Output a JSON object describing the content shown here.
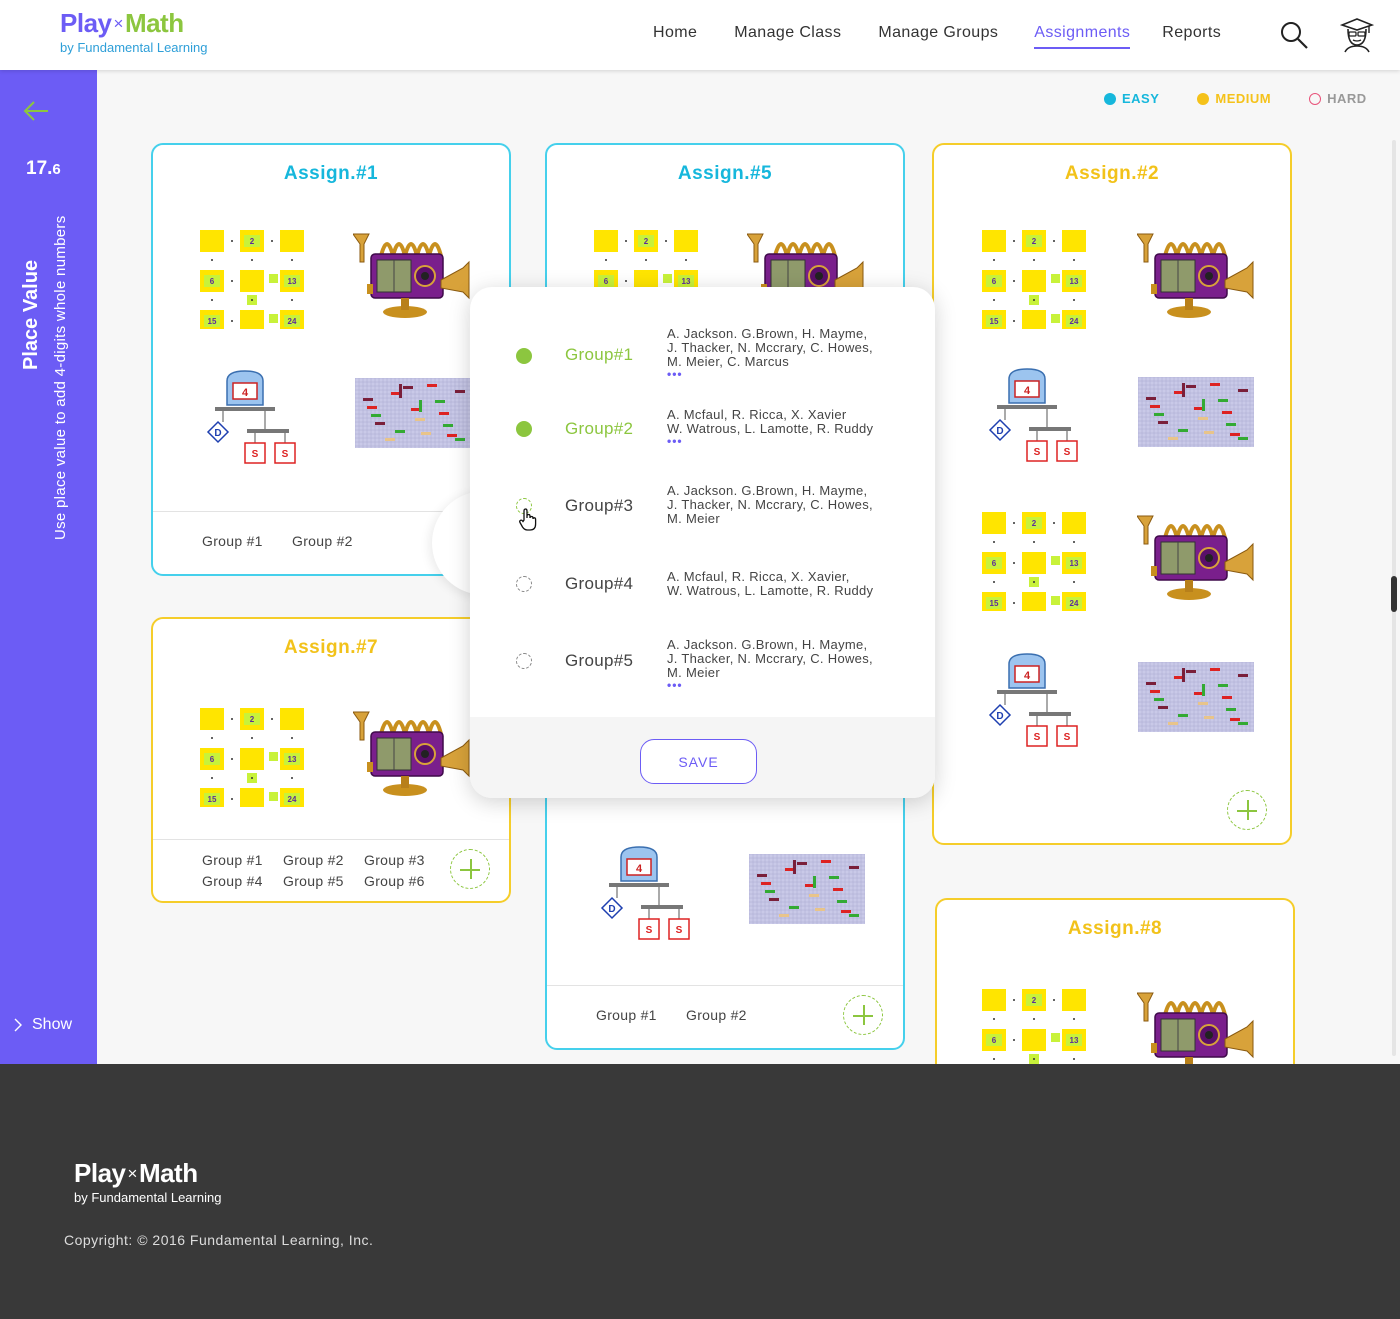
{
  "brand": {
    "play": "Play",
    "x": "×",
    "math": "Math",
    "sub": "by Fundamental Learning"
  },
  "nav": {
    "items": [
      "Home",
      "Manage Class",
      "Manage Groups",
      "Assignments",
      "Reports"
    ],
    "active": "Assignments"
  },
  "sidebar": {
    "lesson_major": "17.",
    "lesson_minor": "6",
    "title": "Place Value",
    "description": "Use place value to add 4-digits whole numbers",
    "show_label": "Show"
  },
  "legend": [
    {
      "label": "EASY",
      "color": "#16b7dc",
      "filled": true
    },
    {
      "label": "MEDIUM",
      "color": "#f5c21a",
      "filled": true
    },
    {
      "label": "HARD",
      "color": "#e8537a",
      "filled": false
    }
  ],
  "cards": {
    "a1": {
      "title": "Assign.#1",
      "difficulty": "easy",
      "groups": [
        "Group #1",
        "Group #2"
      ]
    },
    "a5": {
      "title": "Assign.#5",
      "difficulty": "easy",
      "groups": [
        "Group #1",
        "Group #2"
      ]
    },
    "a2": {
      "title": "Assign.#2",
      "difficulty": "medium",
      "groups": []
    },
    "a7": {
      "title": "Assign.#7",
      "difficulty": "medium",
      "groups": [
        "Group #1",
        "Group #2",
        "Group #3",
        "Group #4",
        "Group #5",
        "Group #6"
      ]
    },
    "a8": {
      "title": "Assign.#8",
      "difficulty": "medium",
      "groups": []
    }
  },
  "game_labels": {
    "grid_numbers": [
      "2",
      "6",
      "13",
      "15",
      "24"
    ],
    "scale_number": "4",
    "diamond": "D",
    "box": "S"
  },
  "popover": {
    "groups": [
      {
        "name": "Group#1",
        "selected": true,
        "members": [
          "A. Jackson. G.Brown, H. Mayme,",
          "J. Thacker, N. Mccrary, C. Howes,",
          "M. Meier, C. Marcus"
        ],
        "more": "•••"
      },
      {
        "name": "Group#2",
        "selected": true,
        "members": [
          "A. Mcfaul, R. Ricca, X. Xavier",
          "W. Watrous, L. Lamotte, R. Ruddy"
        ],
        "more": "•••"
      },
      {
        "name": "Group#3",
        "selected": false,
        "members": [
          "A. Jackson. G.Brown, H. Mayme,",
          "J. Thacker, N. Mccrary, C. Howes,",
          "M. Meier"
        ],
        "more": ""
      },
      {
        "name": "Group#4",
        "selected": false,
        "members": [
          "A. Mcfaul, R. Ricca, X. Xavier,",
          "W. Watrous, L. Lamotte, R. Ruddy"
        ],
        "more": ""
      },
      {
        "name": "Group#5",
        "selected": false,
        "members": [
          "A. Jackson. G.Brown, H. Mayme,",
          "J. Thacker, N. Mccrary, C. Howes,",
          "M. Meier"
        ],
        "more": "•••"
      }
    ],
    "save_label": "SAVE"
  },
  "footer": {
    "copyright": "Copyright: © 2016 Fundamental Learning, Inc."
  }
}
